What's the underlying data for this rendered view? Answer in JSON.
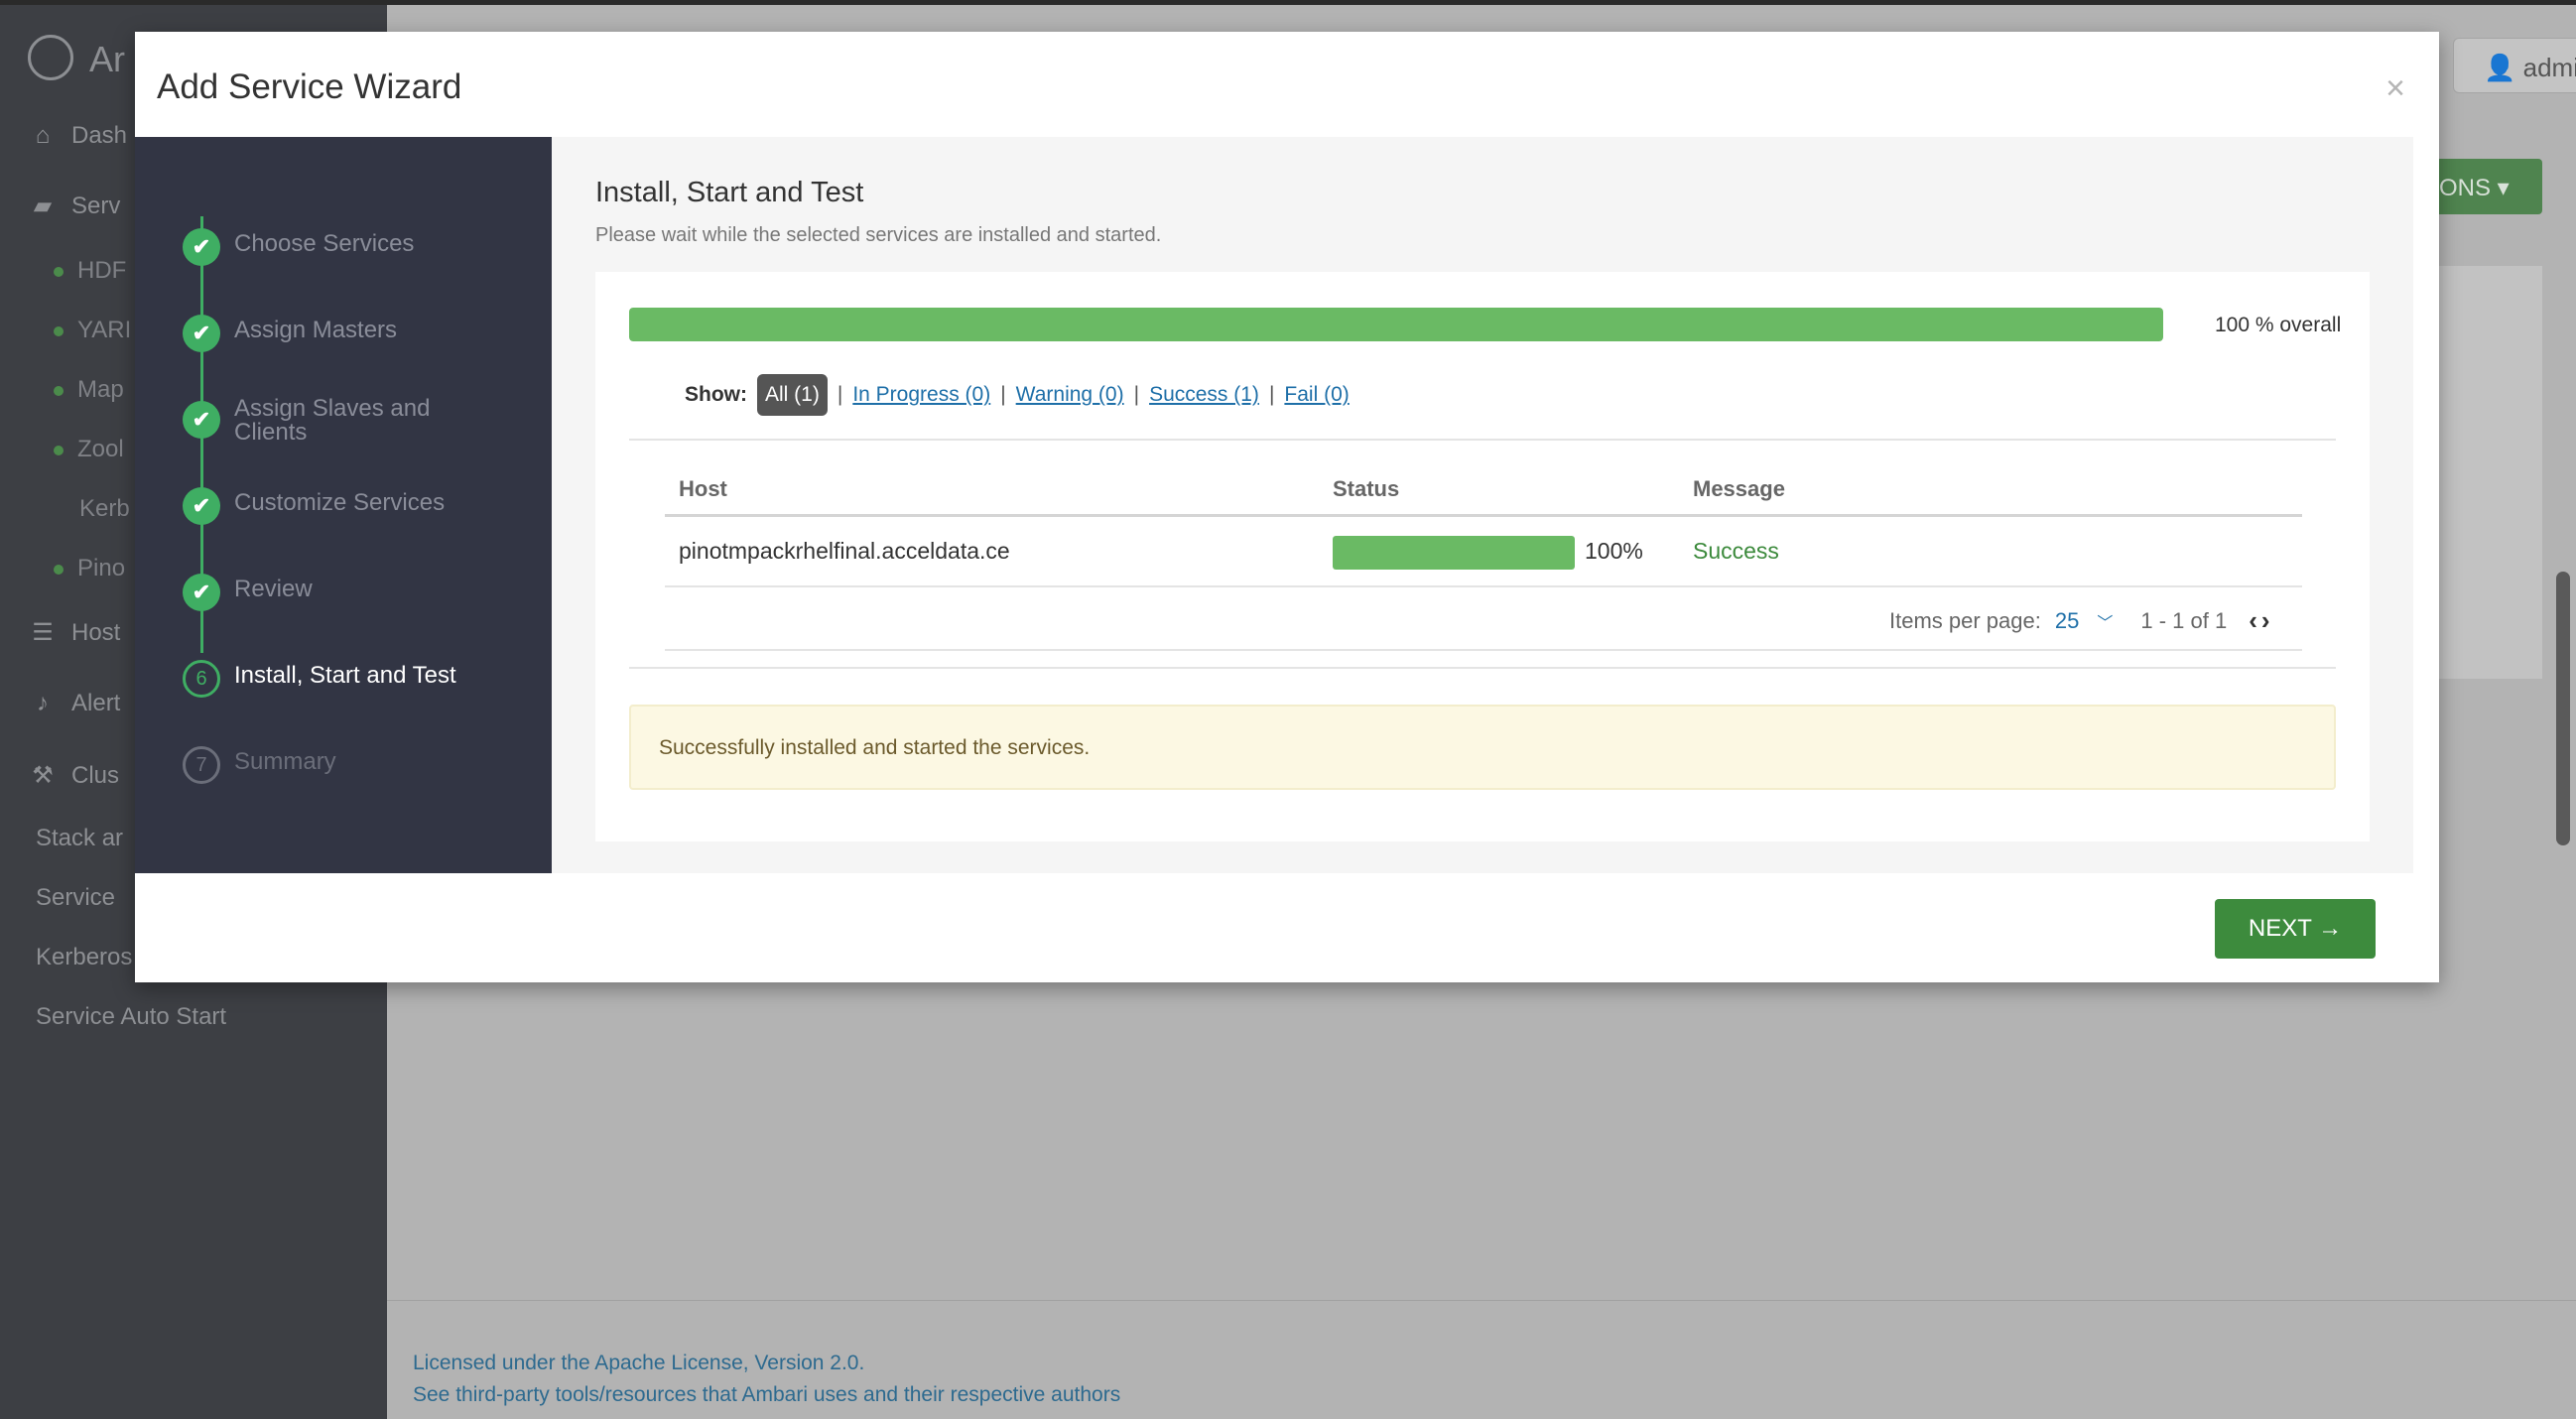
{
  "background": {
    "brand": "Ar",
    "nav": [
      {
        "icon": "home-icon",
        "label": "Dash"
      },
      {
        "icon": "briefcase-icon",
        "label": "Serv"
      },
      {
        "icon": "server-icon",
        "label": "Host"
      },
      {
        "icon": "bell-icon",
        "label": "Alert"
      },
      {
        "icon": "wrench-icon",
        "label": "Clus"
      }
    ],
    "services": [
      "HDF",
      "YARI",
      "Map",
      "Zool",
      "Kerb",
      "Pino"
    ],
    "cluster_links": [
      "Stack ar",
      "Service",
      "Kerberos",
      "Service Auto Start"
    ],
    "user_label": "admi",
    "actions_label": "ONS ▾",
    "footer": {
      "license": "Licensed under the Apache License, Version 2.0.",
      "thirdparty": "See third-party tools/resources that Ambari uses and their respective authors"
    }
  },
  "modal": {
    "title": "Add Service Wizard",
    "close": "×",
    "steps": [
      {
        "num": "✔",
        "label": "Choose Services",
        "state": "done"
      },
      {
        "num": "✔",
        "label": "Assign Masters",
        "state": "done"
      },
      {
        "num": "✔",
        "label": "Assign Slaves and Clients",
        "state": "done"
      },
      {
        "num": "✔",
        "label": "Customize Services",
        "state": "done"
      },
      {
        "num": "✔",
        "label": "Review",
        "state": "done"
      },
      {
        "num": "6",
        "label": "Install, Start and Test",
        "state": "current"
      },
      {
        "num": "7",
        "label": "Summary",
        "state": "todo"
      }
    ],
    "content": {
      "title": "Install, Start and Test",
      "subtitle": "Please wait while the selected services are installed and started.",
      "overall_progress": 100,
      "overall_label": "100 % overall",
      "filters": {
        "show_label": "Show:",
        "all": "All (1)",
        "in_progress": "In Progress (0)",
        "warning": "Warning (0)",
        "success": "Success (1)",
        "fail": "Fail (0)"
      },
      "table": {
        "columns": [
          "Host",
          "Status",
          "Message"
        ],
        "rows": [
          {
            "host": "pinotmpackrhelfinal.acceldata.ce",
            "progress": 100,
            "progress_label": "100%",
            "message": "Success"
          }
        ]
      },
      "pager": {
        "items_per_page_label": "Items per page:",
        "items_per_page": "25",
        "range": "1 - 1 of 1"
      },
      "alert": "Successfully installed and started the services."
    },
    "next_label": "NEXT →"
  },
  "colors": {
    "success_green": "#6aba64",
    "button_green": "#3d8b3d",
    "sidebar_dark": "#323544",
    "link_blue": "#1e6fa8"
  }
}
